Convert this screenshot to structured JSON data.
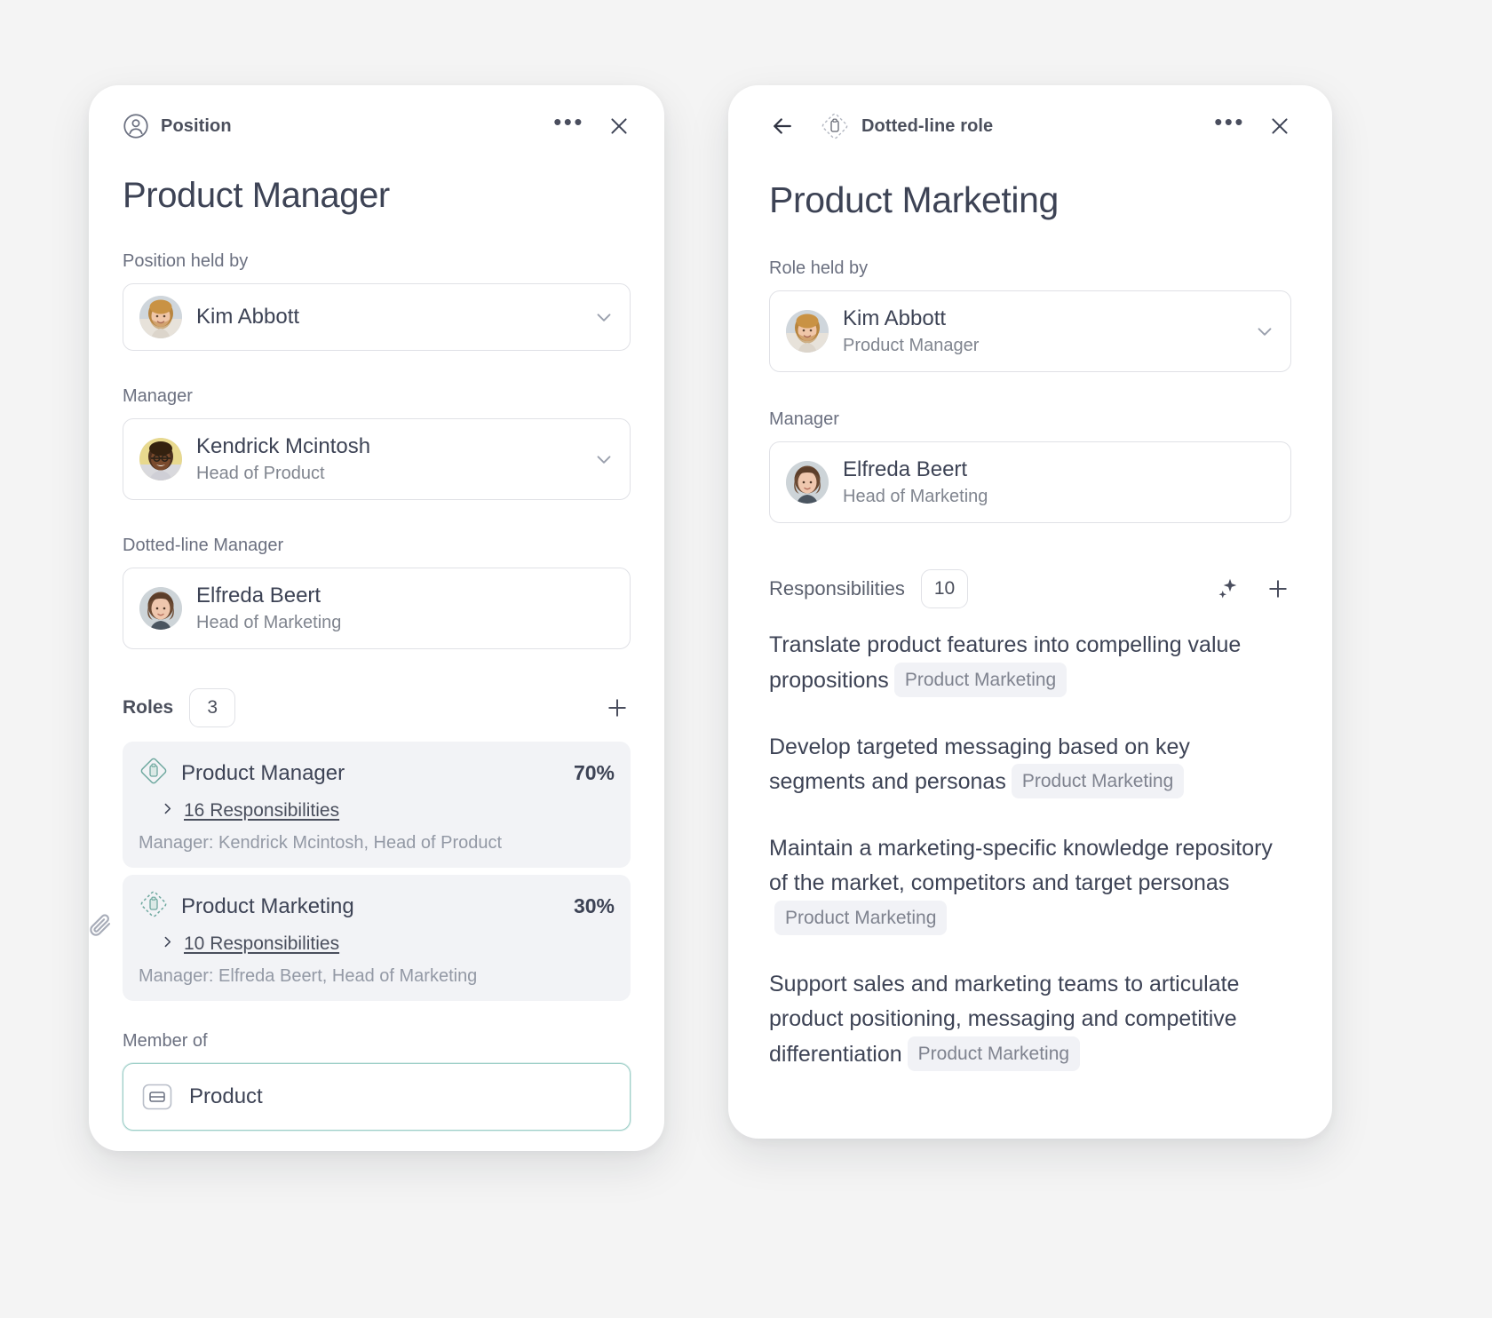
{
  "colors": {
    "background": "#f4f4f4",
    "panel": "#ffffff",
    "text_primary": "#3d4355",
    "text_muted": "#80858f",
    "accent_teal": "#9ecfc8",
    "role_icon_teal": "#6ea89f",
    "card_bg": "#f2f3f6"
  },
  "left_panel": {
    "topbar": {
      "type_icon": "person-circle-icon",
      "type_label": "Position",
      "more_icon": "more-horizontal-icon",
      "close_icon": "close-icon"
    },
    "title": "Product Manager",
    "position_held_by": {
      "label": "Position held by",
      "name": "Kim Abbott",
      "subtitle": "",
      "avatar": "kim-abbott-avatar",
      "chevron_icon": "chevron-down-icon"
    },
    "manager": {
      "label": "Manager",
      "name": "Kendrick Mcintosh",
      "subtitle": "Head of Product",
      "avatar": "kendrick-mcintosh-avatar",
      "chevron_icon": "chevron-down-icon"
    },
    "dotted_line_manager": {
      "label": "Dotted-line Manager",
      "name": "Elfreda Beert",
      "subtitle": "Head of Marketing",
      "avatar": "elfreda-beert-avatar"
    },
    "roles_section": {
      "title": "Roles",
      "count": "3",
      "add_icon": "plus-icon",
      "items": [
        {
          "icon": "role-diamond-icon",
          "icon_style": "solid",
          "name": "Product Manager",
          "percent": "70%",
          "responsibilities_label": "16 Responsibilities",
          "chevron_icon": "chevron-right-icon",
          "manager_line": "Manager: Kendrick Mcintosh, Head of Product",
          "attachment_icon": ""
        },
        {
          "icon": "dotted-role-diamond-icon",
          "icon_style": "dashed",
          "name": "Product Marketing",
          "percent": "30%",
          "responsibilities_label": "10 Responsibilities",
          "chevron_icon": "chevron-right-icon",
          "manager_line": "Manager: Elfreda Beert, Head of Marketing",
          "attachment_icon": "paperclip-icon"
        }
      ]
    },
    "member_of": {
      "label": "Member of",
      "icon": "team-card-icon",
      "value": "Product"
    }
  },
  "right_panel": {
    "topbar": {
      "back_icon": "arrow-left-icon",
      "type_icon": "dotted-role-diamond-icon",
      "type_label": "Dotted-line role",
      "more_icon": "more-horizontal-icon",
      "close_icon": "close-icon"
    },
    "title": "Product Marketing",
    "role_held_by": {
      "label": "Role held by",
      "name": "Kim Abbott",
      "subtitle": "Product Manager",
      "avatar": "kim-abbott-avatar",
      "chevron_icon": "chevron-down-icon"
    },
    "manager": {
      "label": "Manager",
      "name": "Elfreda Beert",
      "subtitle": "Head of Marketing",
      "avatar": "elfreda-beert-avatar"
    },
    "responsibilities_section": {
      "title": "Responsibilities",
      "count": "10",
      "ai_icon": "sparkles-icon",
      "add_icon": "plus-icon",
      "items": [
        {
          "text": "Translate product features into compelling value propositions",
          "tag": "Product Marketing"
        },
        {
          "text": "Develop targeted messaging based on key segments and personas",
          "tag": "Product Marketing"
        },
        {
          "text": "Maintain a marketing-specific knowledge repository of the market, competitors and target personas",
          "tag": "Product Marketing"
        },
        {
          "text": "Support sales and marketing teams to articulate product positioning, messaging and competitive differentiation",
          "tag": "Product Marketing"
        }
      ]
    }
  }
}
